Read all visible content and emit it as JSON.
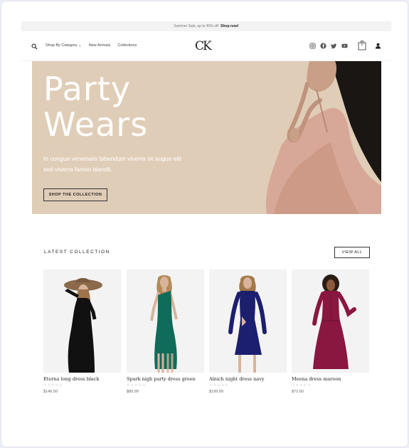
{
  "announcement": {
    "text": "Summer Sale, up to 40% off.",
    "link": "Shop now!"
  },
  "nav": {
    "menu": [
      "Shop By Category",
      "New Arrivals",
      "Collections"
    ],
    "logo": "CK",
    "social": [
      "instagram-icon",
      "facebook-icon",
      "twitter-icon",
      "youtube-icon"
    ],
    "cart_count": "0"
  },
  "hero": {
    "title_line1": "Party",
    "title_line2": "Wears",
    "subtitle": "In congue venenatis bibendum viverra sit augue elit sed viverra fames blandit.",
    "cta": "SHOP THE COLLECTION",
    "background_color": "#e0cdb7"
  },
  "collection": {
    "heading": "LATEST COLLECTION",
    "view_all": "VIEW ALL",
    "products": [
      {
        "name": "Eterna long dress black",
        "price": "$149.50",
        "rating_stars": 5,
        "dress_color": "#111111"
      },
      {
        "name": "Spark nigh party dress green",
        "price": "$89.99",
        "rating_stars": 5,
        "dress_color": "#0f6b5a"
      },
      {
        "name": "Alnich night dress navy",
        "price": "$199.99",
        "rating_stars": 5,
        "dress_color": "#1c1f6e"
      },
      {
        "name": "Meena dress maroon",
        "price": "$72.60",
        "rating_stars": 5,
        "dress_color": "#8a1740"
      }
    ]
  }
}
